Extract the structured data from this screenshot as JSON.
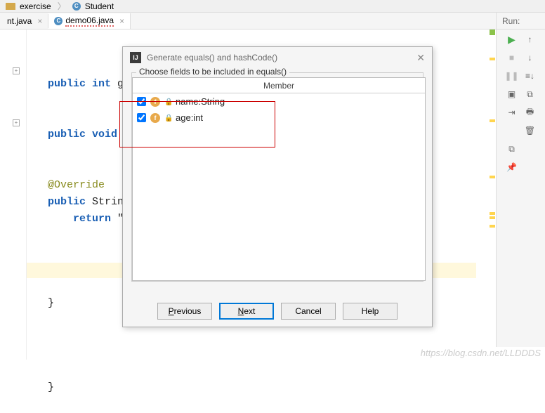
{
  "breadcrumb": {
    "folder": "exercise",
    "class": "Student"
  },
  "tabs": [
    {
      "label": "nt.java",
      "active": false,
      "redline": false
    },
    {
      "label": "demo06.java",
      "active": true,
      "redline": true
    }
  ],
  "runPanel": {
    "title": "Run:"
  },
  "code": {
    "line1_kw": "public int",
    "line1_rest": " g",
    "line2_kw": "public void",
    "line3_ovr": "@Override",
    "line4_kw": "public",
    "line4_type": "Strin",
    "line5_kw": "return",
    "line5_rest": " \"",
    "brace1": "}",
    "brace2": "}"
  },
  "dialog": {
    "title": "Generate equals() and hashCode()",
    "instruction": "Choose fields to be included in equals()",
    "memberHeader": "Member",
    "fields": [
      {
        "name": "name:String",
        "checked": true
      },
      {
        "name": "age:int",
        "checked": true
      }
    ],
    "buttons": {
      "previous": "Previous",
      "next": "Next",
      "cancel": "Cancel",
      "help": "Help"
    }
  },
  "watermark": "https://blog.csdn.net/LLDDDS"
}
